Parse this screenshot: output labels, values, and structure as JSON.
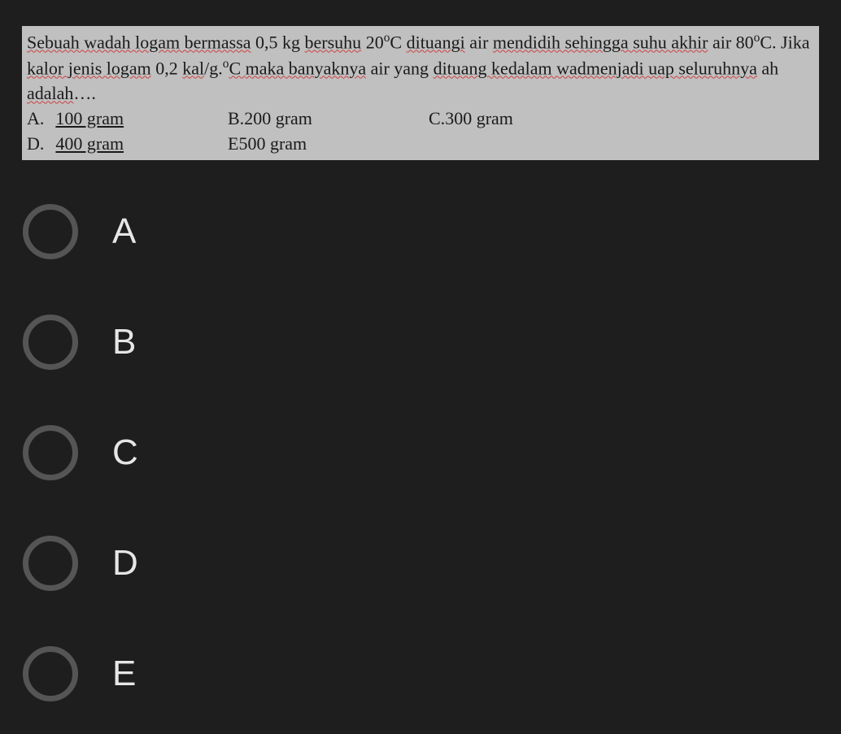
{
  "question": {
    "text_segments": {
      "s1": "Sebuah wadah logam bermassa",
      "s2": " 0,5 kg ",
      "s3": "bersuhu",
      "s4": " 20",
      "s5": "C ",
      "s6": "dituangi",
      "s7": " air ",
      "s8": "mendidih sehingga suhu akhir",
      "s9": " air 80",
      "s10": "C. Jika ",
      "s11": "kalor jenis logam",
      "s12": " 0,2 ",
      "s13": "kal",
      "s14": "/g.",
      "s15": "C ",
      "s16": "maka banyaknya",
      "s17": " air yang ",
      "s18": "dituang kedalam wadmenjadi uap seluruhnya",
      "s19": " ah ",
      "s20": "adalah",
      "s21": "…."
    },
    "degree": "o",
    "inline_options": {
      "a_letter": "A.",
      "a_value": "100 gram",
      "b_letter": "B.",
      "b_value": " 200 gram",
      "c_letter": "C.",
      "c_value": " 300 gram",
      "d_letter": "D.",
      "d_value": "400 gram",
      "e_letter": "E",
      "e_value": " 500 gram"
    }
  },
  "radio_options": {
    "a": "A",
    "b": "B",
    "c": "C",
    "d": "D",
    "e": "E"
  }
}
